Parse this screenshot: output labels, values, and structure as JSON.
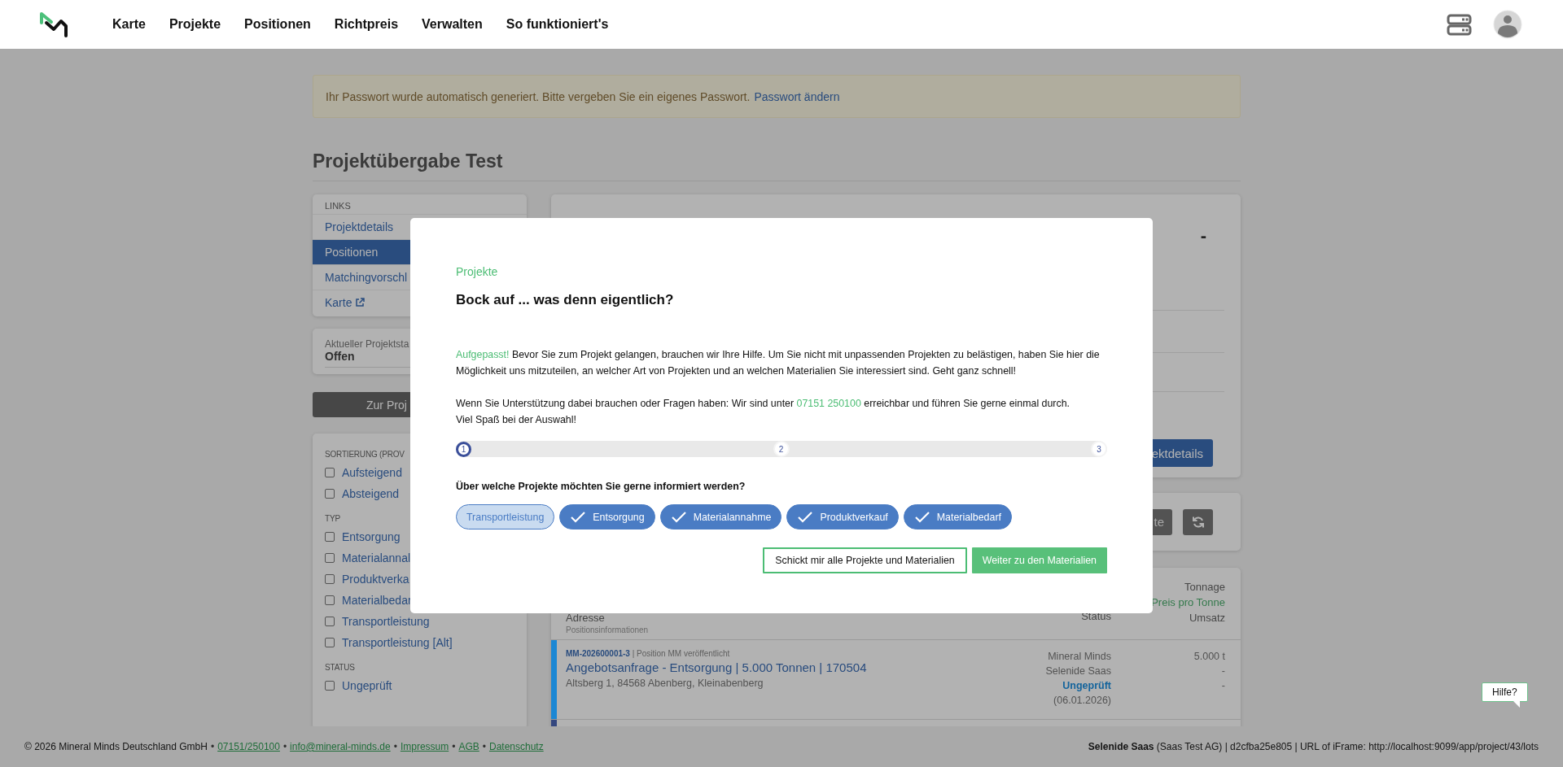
{
  "nav": {
    "items": [
      {
        "label": "Karte"
      },
      {
        "label": "Projekte"
      },
      {
        "label": "Positionen"
      },
      {
        "label": "Richtpreis"
      },
      {
        "label": "Verwalten"
      },
      {
        "label": "So funktioniert's"
      }
    ]
  },
  "banner": {
    "text": "Ihr Passwort wurde automatisch generiert. Bitte vergeben Sie ein eigenes Passwort.",
    "link": "Passwort ändern"
  },
  "page_title": "Projektübergabe Test",
  "links_card": {
    "heading": "LINKS",
    "items": [
      {
        "label": "Projektdetails",
        "selected": false,
        "external": false
      },
      {
        "label": "Positionen",
        "selected": true,
        "external": false
      },
      {
        "label": "Matchingvorschl",
        "selected": false,
        "external": false
      },
      {
        "label": "Karte",
        "selected": false,
        "external": true
      }
    ]
  },
  "status_card": {
    "label": "Aktueller Projektsta",
    "value": "Offen"
  },
  "project_button": "Zur Proj",
  "filters": [
    {
      "heading": "SORTIERUNG (PROV",
      "options": [
        {
          "label": "Aufsteigend",
          "checked": false
        },
        {
          "label": "Absteigend",
          "checked": false
        }
      ]
    },
    {
      "heading": "TYP",
      "options": [
        {
          "label": "Entsorgung",
          "checked": false
        },
        {
          "label": "Materialannal",
          "checked": false
        },
        {
          "label": "Produktverka",
          "checked": false
        },
        {
          "label": "Materialbedar",
          "checked": false
        },
        {
          "label": "Transportleistung",
          "checked": false
        },
        {
          "label": "Transportleistung [Alt]",
          "checked": false
        }
      ]
    },
    {
      "heading": "STATUS",
      "options": [
        {
          "label": "Ungeprüft",
          "checked": false
        }
      ]
    }
  ],
  "details_card": {
    "value": "-",
    "button": "ektdetails"
  },
  "actions_card": {
    "button": "te"
  },
  "table": {
    "left_header": {
      "title": "Adresse",
      "subtitle": "Positionsinformationen"
    },
    "status_header": "Status",
    "value_headers": [
      {
        "label": "Tonnage",
        "highlight": false
      },
      {
        "label": "Preis pro Tonne",
        "highlight": true
      },
      {
        "label": "Umsatz",
        "highlight": false
      }
    ],
    "rows": [
      {
        "id": "MM-202600001-3",
        "state": "| Position MM veröffentlicht",
        "title": "Angebotsanfrage - Entsorgung | 5.000 Tonnen | 170504",
        "address": "Altsberg 1, 84568 Abenberg, Kleinabenberg",
        "parties": [
          "Mineral Minds",
          "Selenide Saas"
        ],
        "status": "Ungeprüft",
        "date": "(06.01.2026)",
        "values": [
          "5.000 t",
          "-",
          "-"
        ],
        "color": "#1b87d4"
      },
      {
        "color": "#34477f"
      }
    ]
  },
  "modal": {
    "eyebrow": "Projekte",
    "title": "Bock auf ... was denn eigentlich?",
    "paragraphs": [
      [
        {
          "text": "Aufgepasst!",
          "highlight": true
        },
        {
          "text": " Bevor Sie zum Projekt gelangen, brauchen wir Ihre Hilfe. Um Sie nicht mit unpassenden Projekten zu belästigen, haben Sie hier die Möglichkeit uns mitzuteilen, an welcher Art von Projekten und an welchen Materialien Sie interessiert sind. Geht ganz schnell!",
          "highlight": false
        }
      ],
      [
        {
          "text": "Wenn Sie Unterstützung dabei brauchen oder Fragen haben: Wir sind unter ",
          "highlight": false
        },
        {
          "text": "07151 250100",
          "highlight": true
        },
        {
          "text": " erreichbar und führen Sie gerne einmal durch.",
          "highlight": false
        }
      ]
    ],
    "closing": "Viel Spaß bei der Auswahl!",
    "steps": [
      {
        "label": "1",
        "selected": true
      },
      {
        "label": "2",
        "selected": false
      },
      {
        "label": "3",
        "selected": false
      }
    ],
    "question": "Über welche Projekte möchten Sie gerne informiert werden?",
    "chips": [
      {
        "label": "Transportleistung",
        "selected": false
      },
      {
        "label": "Entsorgung",
        "selected": true
      },
      {
        "label": "Materialannahme",
        "selected": true
      },
      {
        "label": "Produktverkauf",
        "selected": true
      },
      {
        "label": "Materialbedarf",
        "selected": true
      }
    ],
    "buttons": [
      {
        "label": "Schickt mir alle Projekte und Materialien",
        "kind": "outline"
      },
      {
        "label": "Weiter zu den Materialien",
        "kind": "primary"
      }
    ]
  },
  "footer": {
    "left": [
      {
        "text": "© 2026 Mineral Minds Deutschland GmbH",
        "kind": "text"
      },
      {
        "text": "•",
        "kind": "sep"
      },
      {
        "text": "07151/250100",
        "kind": "link"
      },
      {
        "text": "•",
        "kind": "sep"
      },
      {
        "text": "info@mineral-minds.de",
        "kind": "link"
      },
      {
        "text": "•",
        "kind": "sep"
      },
      {
        "text": "Impressum",
        "kind": "link"
      },
      {
        "text": "•",
        "kind": "sep"
      },
      {
        "text": "AGB",
        "kind": "link"
      },
      {
        "text": "•",
        "kind": "sep"
      },
      {
        "text": "Datenschutz",
        "kind": "link"
      }
    ],
    "right": "**Selenide Saas** (Saas Test AG) | d2cfba25e805 | URL of iFrame: http://localhost:9099/app/project/43/lots"
  },
  "help_bubble": "Hilfe?"
}
